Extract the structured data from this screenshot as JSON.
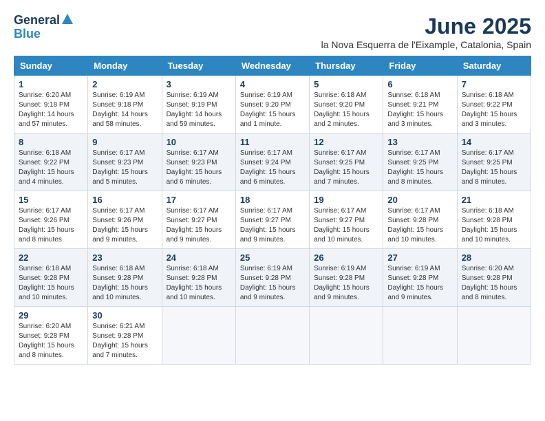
{
  "logo": {
    "line1": "General",
    "line2": "Blue"
  },
  "title": "June 2025",
  "location": "la Nova Esquerra de l'Eixample, Catalonia, Spain",
  "days_of_week": [
    "Sunday",
    "Monday",
    "Tuesday",
    "Wednesday",
    "Thursday",
    "Friday",
    "Saturday"
  ],
  "weeks": [
    [
      {
        "day": "1",
        "sunrise": "6:20 AM",
        "sunset": "9:18 PM",
        "daylight": "14 hours and 57 minutes."
      },
      {
        "day": "2",
        "sunrise": "6:19 AM",
        "sunset": "9:18 PM",
        "daylight": "14 hours and 58 minutes."
      },
      {
        "day": "3",
        "sunrise": "6:19 AM",
        "sunset": "9:19 PM",
        "daylight": "14 hours and 59 minutes."
      },
      {
        "day": "4",
        "sunrise": "6:19 AM",
        "sunset": "9:20 PM",
        "daylight": "15 hours and 1 minute."
      },
      {
        "day": "5",
        "sunrise": "6:18 AM",
        "sunset": "9:20 PM",
        "daylight": "15 hours and 2 minutes."
      },
      {
        "day": "6",
        "sunrise": "6:18 AM",
        "sunset": "9:21 PM",
        "daylight": "15 hours and 3 minutes."
      },
      {
        "day": "7",
        "sunrise": "6:18 AM",
        "sunset": "9:22 PM",
        "daylight": "15 hours and 3 minutes."
      }
    ],
    [
      {
        "day": "8",
        "sunrise": "6:18 AM",
        "sunset": "9:22 PM",
        "daylight": "15 hours and 4 minutes."
      },
      {
        "day": "9",
        "sunrise": "6:17 AM",
        "sunset": "9:23 PM",
        "daylight": "15 hours and 5 minutes."
      },
      {
        "day": "10",
        "sunrise": "6:17 AM",
        "sunset": "9:23 PM",
        "daylight": "15 hours and 6 minutes."
      },
      {
        "day": "11",
        "sunrise": "6:17 AM",
        "sunset": "9:24 PM",
        "daylight": "15 hours and 6 minutes."
      },
      {
        "day": "12",
        "sunrise": "6:17 AM",
        "sunset": "9:25 PM",
        "daylight": "15 hours and 7 minutes."
      },
      {
        "day": "13",
        "sunrise": "6:17 AM",
        "sunset": "9:25 PM",
        "daylight": "15 hours and 8 minutes."
      },
      {
        "day": "14",
        "sunrise": "6:17 AM",
        "sunset": "9:25 PM",
        "daylight": "15 hours and 8 minutes."
      }
    ],
    [
      {
        "day": "15",
        "sunrise": "6:17 AM",
        "sunset": "9:26 PM",
        "daylight": "15 hours and 8 minutes."
      },
      {
        "day": "16",
        "sunrise": "6:17 AM",
        "sunset": "9:26 PM",
        "daylight": "15 hours and 9 minutes."
      },
      {
        "day": "17",
        "sunrise": "6:17 AM",
        "sunset": "9:27 PM",
        "daylight": "15 hours and 9 minutes."
      },
      {
        "day": "18",
        "sunrise": "6:17 AM",
        "sunset": "9:27 PM",
        "daylight": "15 hours and 9 minutes."
      },
      {
        "day": "19",
        "sunrise": "6:17 AM",
        "sunset": "9:27 PM",
        "daylight": "15 hours and 10 minutes."
      },
      {
        "day": "20",
        "sunrise": "6:17 AM",
        "sunset": "9:28 PM",
        "daylight": "15 hours and 10 minutes."
      },
      {
        "day": "21",
        "sunrise": "6:18 AM",
        "sunset": "9:28 PM",
        "daylight": "15 hours and 10 minutes."
      }
    ],
    [
      {
        "day": "22",
        "sunrise": "6:18 AM",
        "sunset": "9:28 PM",
        "daylight": "15 hours and 10 minutes."
      },
      {
        "day": "23",
        "sunrise": "6:18 AM",
        "sunset": "9:28 PM",
        "daylight": "15 hours and 10 minutes."
      },
      {
        "day": "24",
        "sunrise": "6:18 AM",
        "sunset": "9:28 PM",
        "daylight": "15 hours and 10 minutes."
      },
      {
        "day": "25",
        "sunrise": "6:19 AM",
        "sunset": "9:28 PM",
        "daylight": "15 hours and 9 minutes."
      },
      {
        "day": "26",
        "sunrise": "6:19 AM",
        "sunset": "9:28 PM",
        "daylight": "15 hours and 9 minutes."
      },
      {
        "day": "27",
        "sunrise": "6:19 AM",
        "sunset": "9:28 PM",
        "daylight": "15 hours and 9 minutes."
      },
      {
        "day": "28",
        "sunrise": "6:20 AM",
        "sunset": "9:28 PM",
        "daylight": "15 hours and 8 minutes."
      }
    ],
    [
      {
        "day": "29",
        "sunrise": "6:20 AM",
        "sunset": "9:28 PM",
        "daylight": "15 hours and 8 minutes."
      },
      {
        "day": "30",
        "sunrise": "6:21 AM",
        "sunset": "9:28 PM",
        "daylight": "15 hours and 7 minutes."
      },
      null,
      null,
      null,
      null,
      null
    ]
  ],
  "row_shades": [
    "white",
    "shade",
    "white",
    "shade",
    "white"
  ]
}
